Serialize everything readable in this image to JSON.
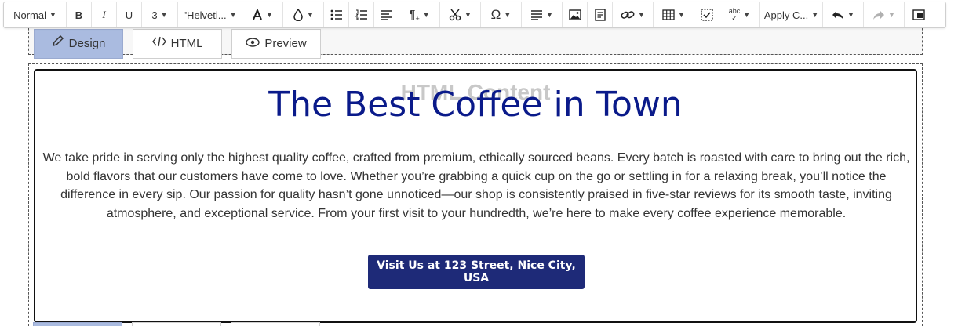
{
  "toolbar": {
    "paragraph_format": "Normal",
    "bold": "B",
    "italic": "I",
    "underline": "U",
    "font_size": "3",
    "font_family": "\"Helveti...",
    "apply_class": "Apply C...",
    "special_char": "Ω",
    "icons": [
      "bold-icon",
      "italic-icon",
      "underline-icon",
      "font-color-icon",
      "background-color-icon",
      "bulleted-list-icon",
      "numbered-list-icon",
      "align-icon",
      "paragraph-style-icon",
      "cut-icon",
      "special-char-icon",
      "block-style-icon",
      "image-icon",
      "document-icon",
      "link-icon",
      "table-icon",
      "checklist-icon",
      "spellcheck-icon",
      "undo-icon",
      "redo-icon",
      "fullscreen-icon"
    ]
  },
  "tabs": {
    "design": "Design",
    "html": "HTML",
    "preview": "Preview"
  },
  "content": {
    "watermark": "HTML Content",
    "headline": "The Best Coffee in Town",
    "paragraph": "We take pride in serving only the highest quality coffee, crafted from premium, ethically sourced beans. Every batch is roasted with care to bring out the rich, bold flavors that our customers have come to love. Whether you’re grabbing a quick cup on the go or settling in for a relaxing break, you’ll notice the difference in every sip. Our passion for quality hasn’t gone unnoticed—our shop is consistently praised in five-star reviews for its smooth taste, inviting atmosphere, and exceptional service. From your first visit to your hundredth, we’re here to make every coffee experience memorable.",
    "cta_label": "Visit Us at 123 Street, Nice City, USA"
  },
  "colors": {
    "headline": "#0a1a8a",
    "cta_background": "#1e2a78",
    "active_tab": "#aabbe0"
  }
}
